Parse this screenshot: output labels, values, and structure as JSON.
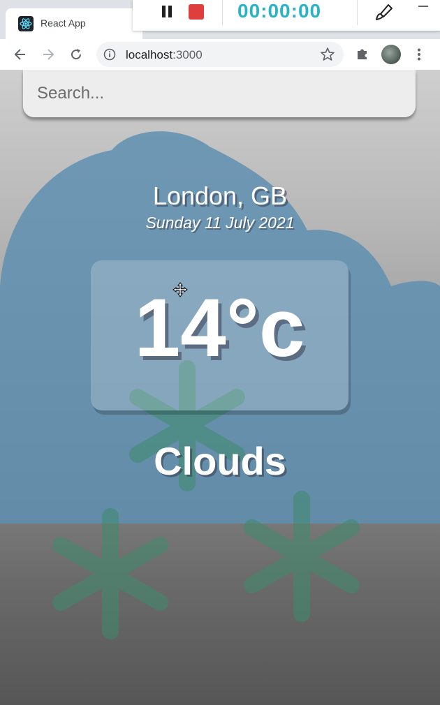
{
  "browser": {
    "tab_title": "React App",
    "url_host": "localhost",
    "url_path": ":3000"
  },
  "recorder": {
    "timer": "00:00:00"
  },
  "search": {
    "placeholder": "Search..."
  },
  "weather": {
    "location": "London, GB",
    "date": "Sunday 11 July 2021",
    "temperature": "14°c",
    "condition": "Clouds"
  },
  "icons": {
    "tab": "react-icon",
    "nav": [
      "back-arrow-icon",
      "forward-arrow-icon",
      "reload-icon"
    ],
    "omnibox": [
      "info-icon",
      "star-icon"
    ],
    "toolbar": [
      "extensions-icon",
      "profile-avatar",
      "menu-kebab-icon"
    ],
    "background": [
      "cloud-icon",
      "snowflake-icon"
    ]
  },
  "colors": {
    "accent_timer": "#2ab3c8",
    "record_stop": "#e03e3e",
    "cloud": "#5f8fb0",
    "snowflake": "#3e8a6c"
  }
}
